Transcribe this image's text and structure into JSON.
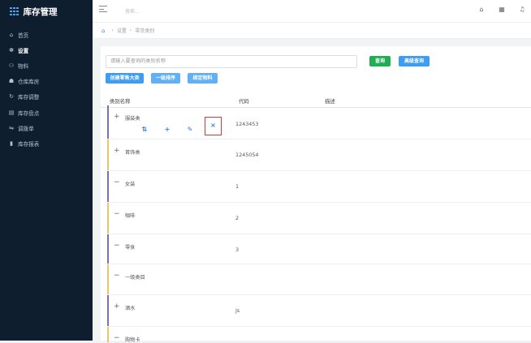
{
  "app": {
    "title": "库存管理"
  },
  "sidebar": {
    "items": [
      {
        "label": "首页",
        "icon": "home-icon",
        "active": false
      },
      {
        "label": "设置",
        "icon": "gear-icon",
        "active": true
      },
      {
        "label": "物料",
        "icon": "box-icon",
        "active": false
      },
      {
        "label": "仓库库房",
        "icon": "warehouse-icon",
        "active": false
      },
      {
        "label": "库存调整",
        "icon": "adjust-icon",
        "active": false
      },
      {
        "label": "库存盘点",
        "icon": "clipboard-icon",
        "active": false
      },
      {
        "label": "调拨单",
        "icon": "transfer-icon",
        "active": false
      },
      {
        "label": "库存报表",
        "icon": "bar-chart-icon",
        "active": false
      }
    ]
  },
  "header": {
    "search_placeholder": "搜索..."
  },
  "breadcrumb": {
    "items": [
      "设置",
      "零货类别"
    ]
  },
  "toolbar": {
    "search_placeholder": "请输入要查询的类别名称",
    "query_label": "查询",
    "advanced_query_label": "高级查询",
    "create_label": "创建零售大类",
    "sort_label": "一级排序",
    "bind_label": "绑定物料"
  },
  "table": {
    "columns": [
      "类别名称",
      "代码",
      "描述"
    ],
    "rows": [
      {
        "toggle": "+",
        "name": "服装类",
        "code": "1243453",
        "bar_color": "#7b6fb5",
        "expanded_actions": true
      },
      {
        "toggle": "+",
        "name": "首饰类",
        "code": "1245054",
        "bar_color": "#e9c667",
        "expanded_actions": false
      },
      {
        "toggle": "−",
        "name": "女装",
        "code": "1",
        "bar_color": "#7b6fb5",
        "expanded_actions": false
      },
      {
        "toggle": "−",
        "name": "咖啡",
        "code": "2",
        "bar_color": "#e9c667",
        "expanded_actions": false
      },
      {
        "toggle": "−",
        "name": "零食",
        "code": "3",
        "bar_color": "#7b6fb5",
        "expanded_actions": false
      },
      {
        "toggle": "−",
        "name": "一级类目",
        "code": "",
        "bar_color": "#e9c667",
        "expanded_actions": false
      },
      {
        "toggle": "+",
        "name": "酒水",
        "code": "js",
        "bar_color": "#7b6fb5",
        "expanded_actions": false
      },
      {
        "toggle": "−",
        "name": "购物卡",
        "code": "",
        "bar_color": "#e9c667",
        "expanded_actions": false
      }
    ],
    "row_actions": [
      {
        "name": "move-icon",
        "glyph": "⇅"
      },
      {
        "name": "add-icon",
        "glyph": "+"
      },
      {
        "name": "edit-icon",
        "glyph": "✎"
      },
      {
        "name": "delete-icon",
        "glyph": "×"
      }
    ]
  }
}
